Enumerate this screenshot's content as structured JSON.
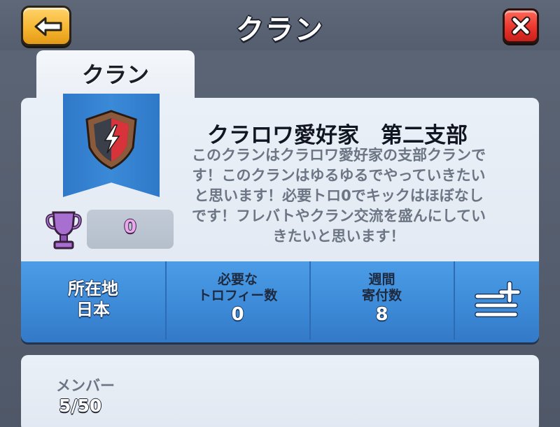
{
  "header": {
    "title": "クラン",
    "back_icon": "arrow-left-icon",
    "close_icon": "close-x-icon"
  },
  "tabs": [
    {
      "label": "クラン",
      "active": true
    }
  ],
  "clan": {
    "name": "クラロワ愛好家　第二支部",
    "description": "このクランはクラロワ愛好家の支部クランです！このクランはゆるゆるでやっていきたいと思います！必要トロ0でキックはほぼなしです！フレバトやクラン交流を盛んにしていきたいと思います！",
    "badge_icon": "clan-badge-lightning-icon",
    "trophies": "0"
  },
  "stats": {
    "location_label": "所在地",
    "location_value": "日本",
    "required_label_1": "必要な",
    "required_label_2": "トロフィー数",
    "required_value": "0",
    "donations_label_1": "週間",
    "donations_label_2": "寄付数",
    "donations_value": "8",
    "more_icon": "list-add-icon"
  },
  "members": {
    "label": "メンバー",
    "value": "5/50"
  },
  "colors": {
    "stats_blue": "#3d8bd8",
    "panel_bg": "#e6edf5",
    "back_button_yellow": "#f5b42e",
    "close_button_red": "#e8322a",
    "trophy_purple": "#a66fd0"
  }
}
